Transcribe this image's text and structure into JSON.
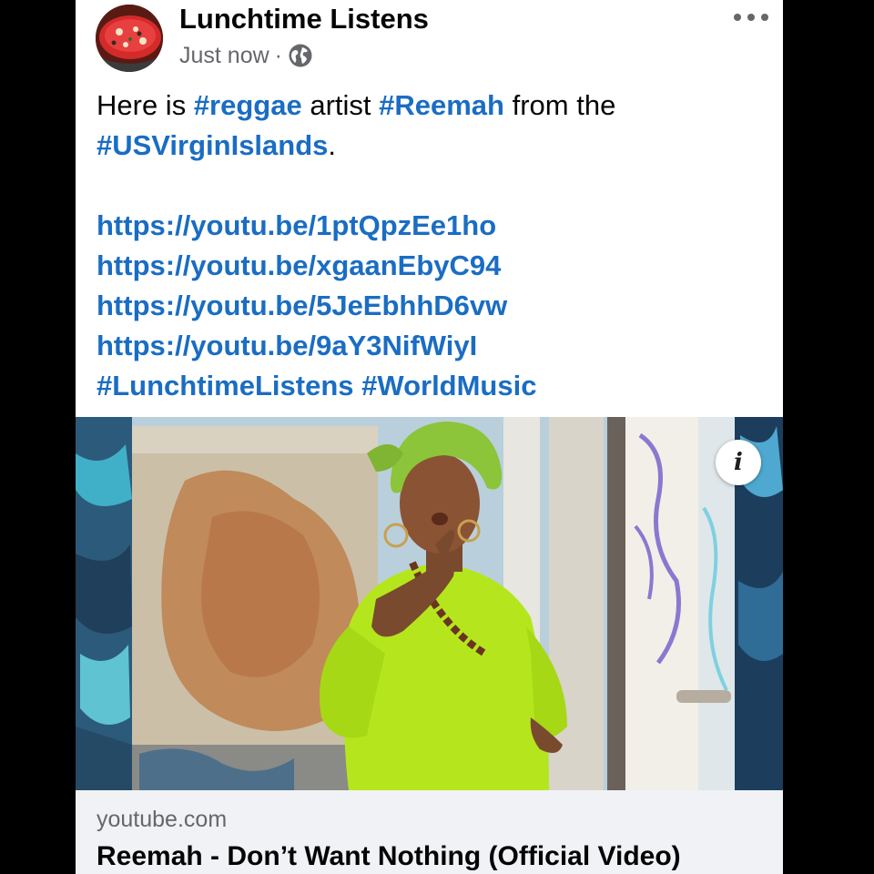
{
  "post": {
    "page_name": "Lunchtime Listens",
    "timestamp": "Just now",
    "separator": "·",
    "audience_icon": "globe-icon",
    "more_icon": "more-options-icon",
    "text": {
      "line1_prefix": "Here is ",
      "tag_reggae": "#reggae",
      "line1_mid": " artist ",
      "tag_reemah": "#Reemah",
      "line1_suffix": " from the",
      "tag_usvi": "#USVirginIslands",
      "line2_suffix": ".",
      "links": [
        "https://youtu.be/1ptQpzEe1ho",
        "https://youtu.be/xgaanEbyC94",
        "https://youtu.be/5JeEbhhD6vw",
        "https://youtu.be/9aY3NifWiyI"
      ],
      "tag_lunchtime": "#LunchtimeListens",
      "tag_worldmusic": "#WorldMusic"
    }
  },
  "media": {
    "info_icon": "info-icon",
    "info_label": "i"
  },
  "link_preview": {
    "domain": "youtube.com",
    "title": "Reemah - Don’t Want Nothing (Official Video)"
  },
  "colors": {
    "background": "#000000",
    "card": "#ffffff",
    "link": "#1a6dc3",
    "text": "#050505",
    "secondary": "#65676b",
    "preview_bg": "#f0f2f5",
    "outfit_green": "#b5e61d"
  }
}
